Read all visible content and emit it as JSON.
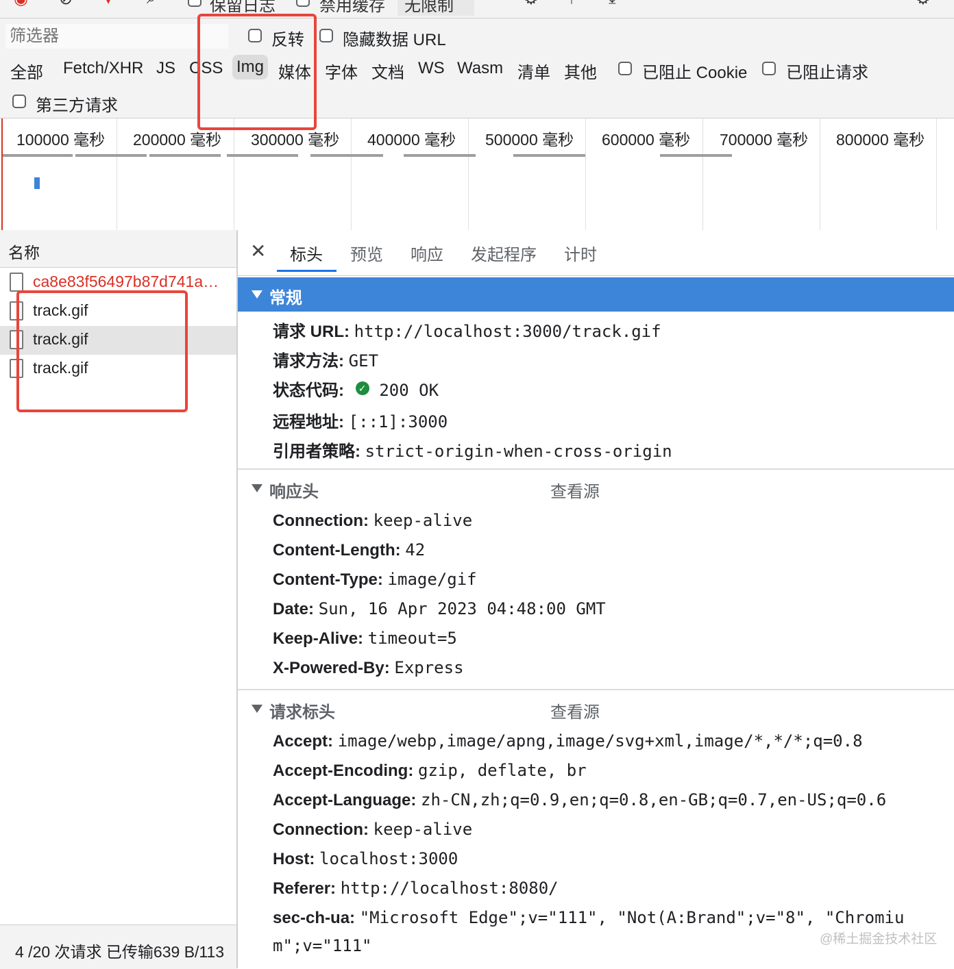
{
  "toolbar": {
    "preserve_log": "保留日志",
    "disable_cache": "禁用缓存",
    "throttle": "无限制"
  },
  "filter": {
    "placeholder": "筛选器",
    "invert": "反转",
    "hide_data_urls": "隐藏数据 URL",
    "types": [
      "全部",
      "Fetch/XHR",
      "JS",
      "CSS",
      "Img",
      "媒体",
      "字体",
      "文档",
      "WS",
      "Wasm",
      "清单",
      "其他"
    ],
    "active_type": "Img",
    "blocked_cookies": "已阻止 Cookie",
    "blocked_requests": "已阻止请求",
    "third_party": "第三方请求"
  },
  "timeline": {
    "ticks": [
      "100000  毫秒",
      "200000  毫秒",
      "300000  毫秒",
      "400000  毫秒",
      "500000  毫秒",
      "600000  毫秒",
      "700000  毫秒",
      "800000  毫秒"
    ]
  },
  "requests": {
    "column": "名称",
    "items": [
      {
        "name": "ca8e83f56497b87d741a…",
        "color": "#d93025"
      },
      {
        "name": "track.gif"
      },
      {
        "name": "track.gif",
        "selected": true
      },
      {
        "name": "track.gif"
      }
    ],
    "footer": "4 /20 次请求  已传输639 B/113"
  },
  "details": {
    "tabs": [
      "标头",
      "预览",
      "响应",
      "发起程序",
      "计时"
    ],
    "active_tab": "标头",
    "general": {
      "title": "常规",
      "rows": [
        {
          "k": "请求 URL:",
          "v": "http://localhost:3000/track.gif"
        },
        {
          "k": "请求方法:",
          "v": "GET"
        },
        {
          "k": "状态代码:",
          "v": "200 OK"
        },
        {
          "k": "远程地址:",
          "v": "[::1]:3000"
        },
        {
          "k": "引用者策略:",
          "v": "strict-origin-when-cross-origin"
        }
      ]
    },
    "response_headers": {
      "title": "响应头",
      "view_source": "查看源",
      "rows": [
        {
          "k": "Connection:",
          "v": "keep-alive"
        },
        {
          "k": "Content-Length:",
          "v": "42"
        },
        {
          "k": "Content-Type:",
          "v": "image/gif"
        },
        {
          "k": "Date:",
          "v": "Sun, 16 Apr 2023 04:48:00 GMT"
        },
        {
          "k": "Keep-Alive:",
          "v": "timeout=5"
        },
        {
          "k": "X-Powered-By:",
          "v": "Express"
        }
      ]
    },
    "request_headers": {
      "title": "请求标头",
      "view_source": "查看源",
      "rows": [
        {
          "k": "Accept:",
          "v": "image/webp,image/apng,image/svg+xml,image/*,*/*;q=0.8"
        },
        {
          "k": "Accept-Encoding:",
          "v": "gzip, deflate, br"
        },
        {
          "k": "Accept-Language:",
          "v": "zh-CN,zh;q=0.9,en;q=0.8,en-GB;q=0.7,en-US;q=0.6"
        },
        {
          "k": "Connection:",
          "v": "keep-alive"
        },
        {
          "k": "Host:",
          "v": "localhost:3000"
        },
        {
          "k": "Referer:",
          "v": "http://localhost:8080/"
        },
        {
          "k": "sec-ch-ua:",
          "v": "\"Microsoft Edge\";v=\"111\", \"Not(A:Brand\";v=\"8\", \"Chromiu"
        },
        {
          "k": "",
          "v": "m\";v=\"111\""
        }
      ]
    }
  },
  "watermark": "@稀土掘金技术社区",
  "colors": {
    "accent": "#1a73e8",
    "section_blue": "#3d85d8",
    "highlight_red": "#e8453c",
    "status_green": "#1e8e3e"
  }
}
